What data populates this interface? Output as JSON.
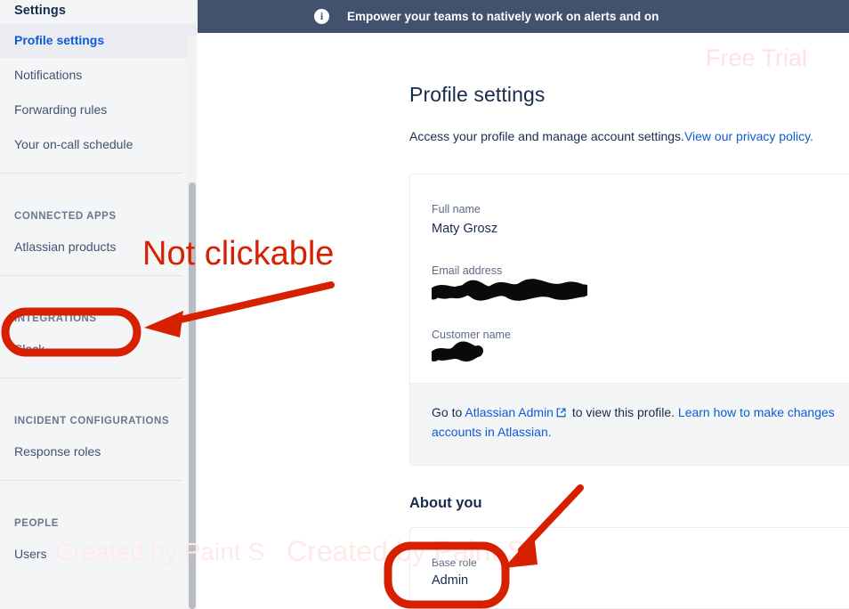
{
  "sidebar": {
    "title": "Settings",
    "groups": [
      {
        "items": [
          {
            "label": "Profile settings",
            "active": true
          },
          {
            "label": "Notifications",
            "active": false
          },
          {
            "label": "Forwarding rules",
            "active": false
          },
          {
            "label": "Your on-call schedule",
            "active": false
          }
        ]
      },
      {
        "heading": "CONNECTED APPS",
        "items": [
          {
            "label": "Atlassian products",
            "active": false
          }
        ]
      },
      {
        "heading": "INTEGRATIONS",
        "items": [
          {
            "label": "Slack",
            "active": false
          }
        ]
      },
      {
        "heading": "INCIDENT CONFIGURATIONS",
        "items": [
          {
            "label": "Response roles",
            "active": false
          }
        ]
      },
      {
        "heading": "PEOPLE",
        "items": [
          {
            "label": "Users",
            "active": false
          }
        ]
      }
    ]
  },
  "banner": {
    "icon": "info-icon",
    "text": "Empower your teams to natively work on alerts and on"
  },
  "page": {
    "title": "Profile settings",
    "subtitle": "Access your profile and manage account settings.",
    "subtitle_link": "View our privacy policy.",
    "profile_fields": [
      {
        "label": "Full name",
        "value": "Maty Grosz",
        "redacted": false
      },
      {
        "label": "Email address",
        "value": "",
        "redacted": true
      },
      {
        "label": "Customer name",
        "value": "",
        "redacted": true
      }
    ],
    "notice": {
      "lead": "Go to ",
      "link1": "Atlassian Admin",
      "mid": " to view this profile. ",
      "link2": "Learn how to make changes",
      "link2_line2": "accounts in Atlassian."
    },
    "about_title": "About you",
    "about_fields": [
      {
        "label": "Base role",
        "value": "Admin"
      }
    ]
  },
  "annotations": {
    "note_text": "Not clickable",
    "accent_color": "#d62000"
  },
  "watermarks": {
    "free_trial": "Free Trial",
    "paint_a": "Created by Paint S",
    "paint_b": "Created by Paint S"
  }
}
